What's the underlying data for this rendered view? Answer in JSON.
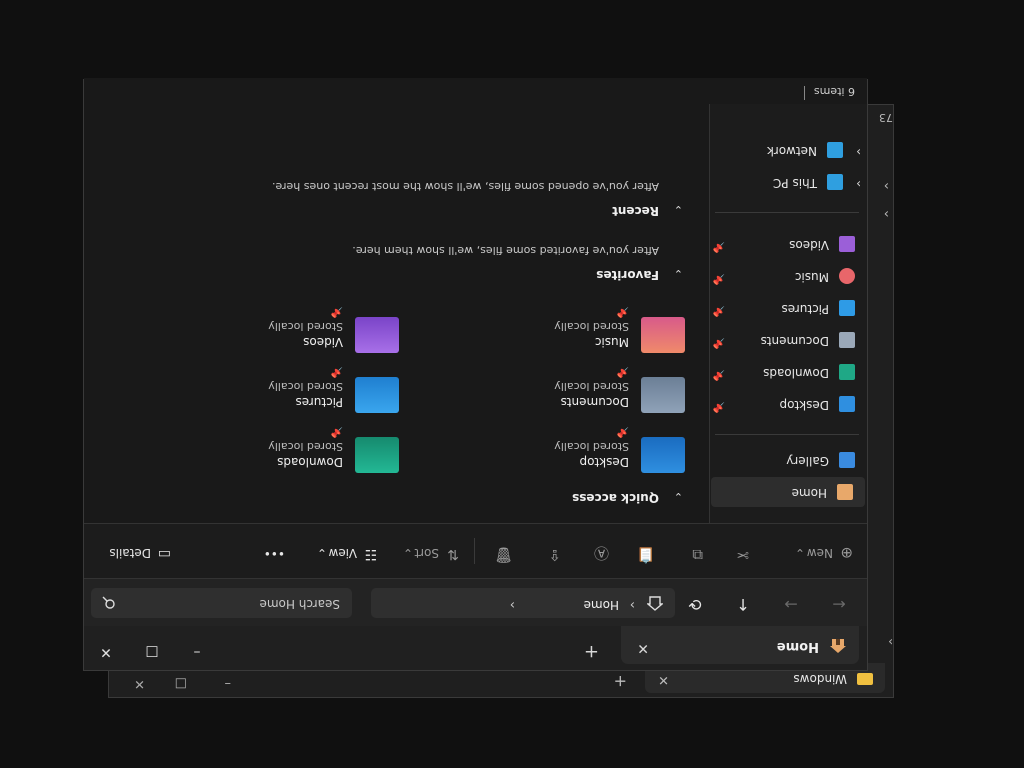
{
  "colors": {
    "accent": "#3a8be0",
    "folder": "#f0c040"
  },
  "background_window": {
    "tab_label": "Windows",
    "partial_text": "73"
  },
  "window": {
    "tab": {
      "label": "Home",
      "icon": "home-icon"
    },
    "controls": {
      "minimize": "–",
      "maximize": "□",
      "close": "✕",
      "new_tab": "+",
      "tab_close": "✕"
    },
    "nav": {
      "back": "←",
      "forward": "→",
      "up": "↑",
      "refresh": "⟳",
      "breadcrumb_home_icon": "home-icon",
      "breadcrumb_sep": "›",
      "breadcrumb_label": "Home",
      "search_placeholder": "Search Home"
    },
    "toolbar": {
      "new_label": "New",
      "sort_label": "Sort",
      "view_label": "View",
      "more_label": "•••",
      "details_label": "Details"
    },
    "sidebar": {
      "home": "Home",
      "gallery": "Gallery",
      "pinned": [
        {
          "label": "Desktop",
          "icon": "desktop-icon"
        },
        {
          "label": "Downloads",
          "icon": "downloads-icon"
        },
        {
          "label": "Documents",
          "icon": "documents-icon"
        },
        {
          "label": "Pictures",
          "icon": "pictures-icon"
        },
        {
          "label": "Music",
          "icon": "music-icon"
        },
        {
          "label": "Videos",
          "icon": "videos-icon"
        }
      ],
      "this_pc": "This PC",
      "network": "Network"
    },
    "quick_access": {
      "title": "Quick access",
      "items": [
        {
          "name": "Desktop",
          "sub": "Stored locally",
          "icon": "desktop-folder-icon"
        },
        {
          "name": "Downloads",
          "sub": "Stored locally",
          "icon": "downloads-folder-icon"
        },
        {
          "name": "Documents",
          "sub": "Stored locally",
          "icon": "documents-folder-icon"
        },
        {
          "name": "Pictures",
          "sub": "Stored locally",
          "icon": "pictures-folder-icon"
        },
        {
          "name": "Music",
          "sub": "Stored locally",
          "icon": "music-folder-icon"
        },
        {
          "name": "Videos",
          "sub": "Stored locally",
          "icon": "videos-folder-icon"
        }
      ]
    },
    "favorites": {
      "title": "Favorites",
      "hint": "After you've favorited some files, we'll show them here."
    },
    "recent": {
      "title": "Recent",
      "hint": "After you've opened some files, we'll show the most recent ones here."
    },
    "status": {
      "count": "6 items"
    }
  }
}
